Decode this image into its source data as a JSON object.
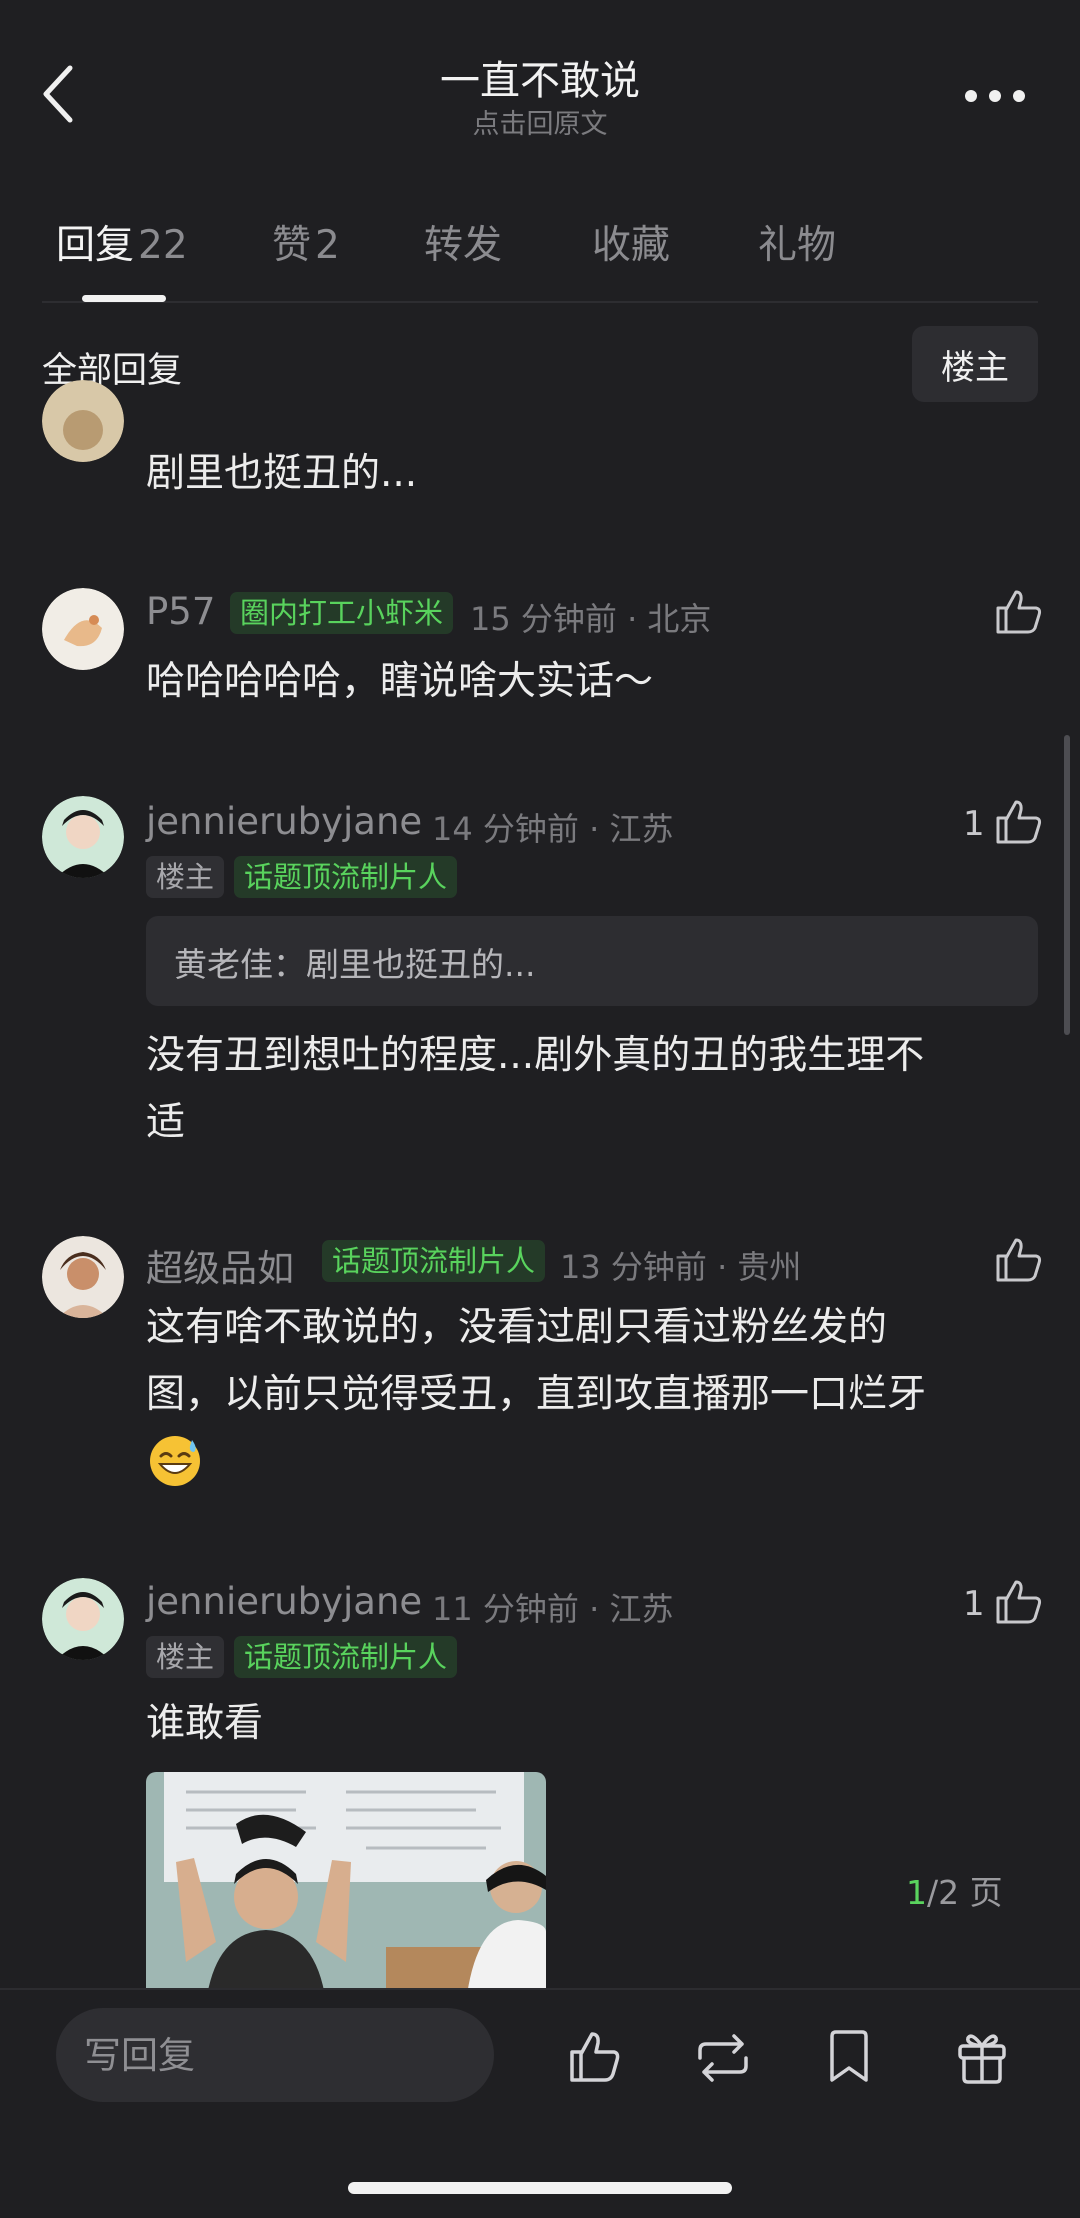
{
  "header": {
    "title": "一直不敢说",
    "subtitle": "点击回原文"
  },
  "tabs": [
    {
      "label": "回复",
      "count": "22",
      "active": true
    },
    {
      "label": "赞",
      "count": "2",
      "active": false
    },
    {
      "label": "转发",
      "count": "",
      "active": false
    },
    {
      "label": "收藏",
      "count": "",
      "active": false
    },
    {
      "label": "礼物",
      "count": "",
      "active": false
    }
  ],
  "section": {
    "all_replies_label": "全部回复",
    "filter_button": "楼主"
  },
  "comments": [
    {
      "content_lines": [
        "剧里也挺丑的..."
      ]
    },
    {
      "username": "P57",
      "badges": [
        {
          "text": "圈内打工小虾米",
          "style": "green"
        }
      ],
      "meta": "15 分钟前 · 北京",
      "like_count": "",
      "content_lines": [
        "哈哈哈哈哈，瞎说啥大实话～"
      ]
    },
    {
      "username": "jennierubyjane",
      "meta": "14 分钟前 · 江苏",
      "badges": [
        {
          "text": "楼主",
          "style": "gray"
        },
        {
          "text": "话题顶流制片人",
          "style": "green"
        }
      ],
      "like_count": "1",
      "quote": "黄老佳：剧里也挺丑的...",
      "content_lines": [
        "没有丑到想吐的程度...剧外真的丑的我生理不",
        "适"
      ]
    },
    {
      "username": "超级品如",
      "badges": [
        {
          "text": "话题顶流制片人",
          "style": "green"
        }
      ],
      "meta": "13 分钟前 · 贵州",
      "like_count": "",
      "content_lines": [
        "这有啥不敢说的，没看过剧只看过粉丝发的",
        "图，以前只觉得受丑，直到攻直播那一口烂牙"
      ],
      "emoji": "sweat-smile"
    },
    {
      "username": "jennierubyjane",
      "meta": "11 分钟前 · 江苏",
      "badges": [
        {
          "text": "楼主",
          "style": "gray"
        },
        {
          "text": "话题顶流制片人",
          "style": "green"
        }
      ],
      "like_count": "1",
      "content_lines": [
        "谁敢看"
      ],
      "has_image": true
    }
  ],
  "pagination": {
    "current": "1",
    "total": "/2 页"
  },
  "bottom_bar": {
    "reply_placeholder": "写回复",
    "icons": [
      "thumbs-up-icon",
      "repost-icon",
      "bookmark-icon",
      "gift-icon"
    ]
  },
  "colors": {
    "background": "#1f1f22",
    "badge_green_text": "#59d35d",
    "badge_green_bg": "#243a28",
    "page_accent": "#5ad35e"
  }
}
